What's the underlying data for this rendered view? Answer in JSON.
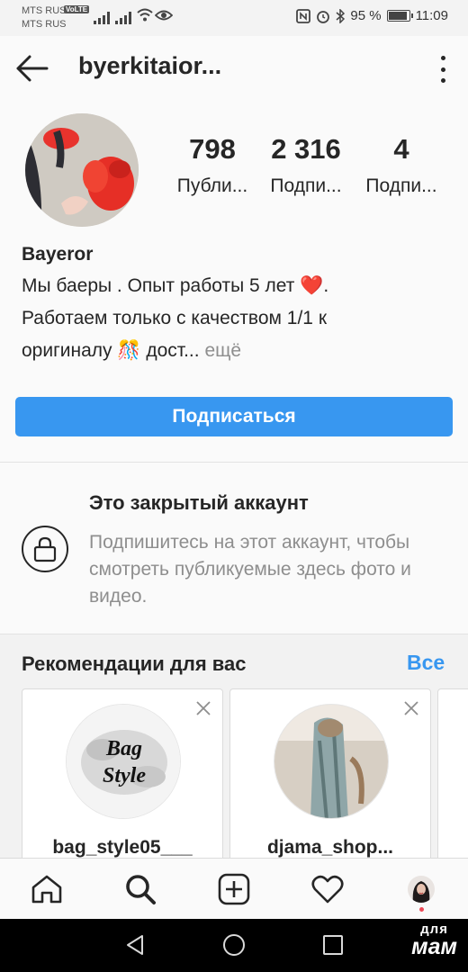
{
  "status_bar": {
    "carrier_1": "MTS RUS",
    "carrier_2": "MTS RUS",
    "volte": "VoLTE",
    "battery": "95 %",
    "time": "11:09"
  },
  "header": {
    "username": "byerkitaior...",
    "back_icon": "arrow-left-icon",
    "more_icon": "vertical-dots-icon"
  },
  "profile": {
    "stats": [
      {
        "value": "798",
        "label": "Публи..."
      },
      {
        "value": "2 316",
        "label": "Подпи..."
      },
      {
        "value": "4",
        "label": "Подпи..."
      }
    ],
    "name": "Bayeror",
    "bio_line1": "Мы баеры . Опыт работы 5 лет",
    "bio_line1_end": ".",
    "bio_heart": "❤️",
    "bio_line2": "Работаем только с качеством 1/1 к",
    "bio_line3": "оригиналу",
    "bio_emoji": "🎊",
    "bio_line3_rest": "дост...",
    "bio_more": "ещё",
    "follow_button": "Подписаться"
  },
  "private": {
    "title": "Это закрытый аккаунт",
    "description": "Подпишитесь на этот аккаунт, чтобы смотреть публикуемые здесь фото и видео.",
    "icon": "lock-icon"
  },
  "recommendations": {
    "title": "Рекомендации для вас",
    "see_all": "Все",
    "cards": [
      {
        "username": "bag_style05___",
        "avatar_text_1": "Bag",
        "avatar_text_2": "Style"
      },
      {
        "username": "djama_shop..."
      }
    ]
  },
  "bottom_nav": {
    "items": [
      "home-icon",
      "search-icon",
      "new-post-icon",
      "activity-heart-icon",
      "profile-avatar"
    ]
  },
  "system_nav": {
    "items": [
      "back-triangle-icon",
      "home-circle-icon",
      "recents-square-icon"
    ],
    "watermark_1": "для",
    "watermark_2": "мам"
  },
  "colors": {
    "accent": "#3897f0",
    "text": "#262626",
    "secondary": "#8e8e8e",
    "background": "#fafafa"
  }
}
